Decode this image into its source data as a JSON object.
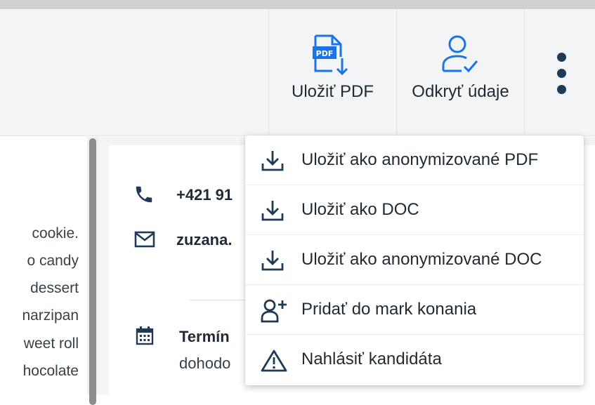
{
  "toolbar": {
    "save_pdf_label": "Uložiť PDF",
    "reveal_label": "Odkryť údaje",
    "more_icon": "more-vertical-icon"
  },
  "menu": {
    "items": [
      {
        "label": "Uložiť ako anonymizované PDF",
        "icon": "download-icon"
      },
      {
        "label": "Uložiť ako DOC",
        "icon": "download-icon"
      },
      {
        "label": "Uložiť ako anonymizované DOC",
        "icon": "download-icon"
      },
      {
        "label": "Pridať do mark konania",
        "icon": "add-user-icon"
      },
      {
        "label": "Nahlásiť kandidáta",
        "icon": "warning-icon"
      }
    ]
  },
  "left_text": {
    "lines": [
      "cookie.",
      "o  candy",
      "dessert",
      "narzipan",
      "weet roll",
      "hocolate"
    ]
  },
  "contact": {
    "phone": "+421 91",
    "email": "zuzana.",
    "term_label": "Termín",
    "term_value": "dohodo"
  },
  "colors": {
    "accent": "#1a73e8",
    "icon_dark": "#1f3a57",
    "toolbar_bg": "#f3f4f5"
  }
}
